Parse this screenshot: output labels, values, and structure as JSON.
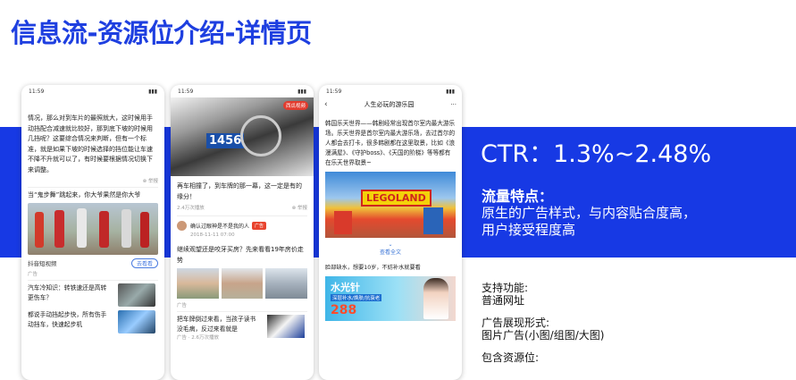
{
  "page_title": "信息流-资源位介绍-详情页",
  "phones": {
    "status_time": "11:59",
    "p1": {
      "para": "情况，那么对到车片的最照就大，这时候用手动挡配合减速就比较好，那到底下坡的时候用几挡呢？这要综合情况来判断，但有一个标准，就是如果下坡的时候选择的挡位能让车速不降不升就可以了，有时候要根据情况切换下来调整。",
      "report": "举报",
      "video_title": "当“鬼步舞”跳起来，你大爷果然是你大爷",
      "video_source": "抖音短视频",
      "video_button": "去看看",
      "ad_label": "广告",
      "item1": "汽车冷知识：转铁速还是高转更伤车？",
      "item2": "都说手动挡起步快，所有伤手动挡车，快速起步机"
    },
    "p2": {
      "badge": "西瓜视频",
      "plate": "1456",
      "headline": "再车相撞了，到车牌的那一幕，这一定是有的缘分！",
      "meta": "2.4万次播放",
      "ad_user": "确认过眼神是不是我的人",
      "ad_tag": "广告",
      "ad_date": "2018-11-11 07:00",
      "q1": "继续观望还是咬牙买房？先来看看19年房价走势",
      "q1_meta": "广告",
      "q2": "把车牌倒过来看，当孩子读书没毛病，反过来看就是",
      "q2_meta": "广告 · 2.6万次播放"
    },
    "p3": {
      "nav_title": "人生必玩的游乐园",
      "article": "韩国乐天世界——韩剧经常出现首尔室内最大游乐场。乐天世界是首尔室内最大游乐场，去过首尔的人都会去打卡，很多韩剧都在这里取景，比如《浪漫满屋》、《守护boss》、《天国的阶梯》等等都有在乐天世界取景~",
      "legoland": "LEGOLAND",
      "expand": "查看全文",
      "ad_text": "脸部缺水，想要10岁，不妨补水就要看",
      "ad_banner": "水光针",
      "ad_sub": "深层补水/焕肤/抗衰老",
      "ad_price": "288"
    }
  },
  "right": {
    "ctr": "CTR：1.3%~2.48%",
    "traffic_heading": "流量特点：",
    "traffic_lines": [
      "原生的广告样式，与内容贴合度高，",
      "用户接受程度高"
    ],
    "support_heading": "支持功能:",
    "support_value": "普通网址",
    "format_heading": "广告展现形式:",
    "format_value": "图片广告(小图/组图/大图)",
    "include_heading": "包含资源位:"
  }
}
